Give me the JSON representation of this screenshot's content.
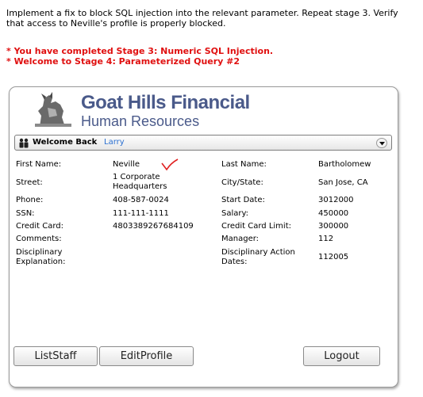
{
  "instructions": "Implement a fix to block SQL injection into the relevant parameter. Repeat stage 3. Verify that access to Neville's profile is properly blocked.",
  "messages": [
    "* You have completed Stage 3: Numeric SQL Injection.",
    "* Welcome to Stage 4: Parameterized Query #2"
  ],
  "app": {
    "logo_title": "Goat Hills Financial",
    "logo_subtitle": "Human Resources",
    "welcome_label": "Welcome Back",
    "welcome_user": "Larry"
  },
  "profile": {
    "first_name_label": "First Name:",
    "first_name": "Neville",
    "last_name_label": "Last Name:",
    "last_name": "Bartholomew",
    "street_label": "Street:",
    "street_line1": "1 Corporate",
    "street_line2": "Headquarters",
    "city_label": "City/State:",
    "city": "San Jose, CA",
    "phone_label": "Phone:",
    "phone": "408-587-0024",
    "start_date_label": "Start Date:",
    "start_date": "3012000",
    "ssn_label": "SSN:",
    "ssn": "111-111-1111",
    "salary_label": "Salary:",
    "salary": "450000",
    "credit_card_label": "Credit Card:",
    "credit_card": "4803389267684109",
    "credit_limit_label": "Credit Card Limit:",
    "credit_limit": "300000",
    "comments_label": "Comments:",
    "manager_label": "Manager:",
    "manager": "112",
    "disc_expl_label_1": "Disciplinary",
    "disc_expl_label_2": "Explanation:",
    "disc_dates_label_1": "Disciplinary Action",
    "disc_dates_label_2": "Dates:",
    "disc_dates": "112005"
  },
  "buttons": {
    "list_staff": "ListStaff",
    "edit_profile": "EditProfile",
    "logout": "Logout"
  },
  "icons": {
    "welcome": "people-icon",
    "dropdown": "chevron-down-icon",
    "annotation": "checkmark-icon",
    "logo": "goat-logo-icon"
  },
  "colors": {
    "message": "#e01010",
    "logo": "#4a5a8a",
    "user_link": "#2a6fd0",
    "checkmark": "#e02020"
  }
}
